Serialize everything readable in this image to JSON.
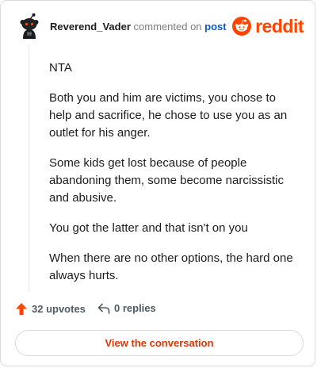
{
  "header": {
    "author": "Reverend_Vader",
    "action_text": "commented on",
    "post_link": "post",
    "brand": "reddit"
  },
  "comment": {
    "paragraphs": [
      "NTA",
      "Both you and him are victims, you chose to help and sacrifice, he chose to use you as an outlet for his anger.",
      "Some kids get lost because of people abandoning them, some become narcissistic and abusive.",
      "You got the latter and that isn't on you",
      "When there are no other options, the hard one always hurts."
    ]
  },
  "actions": {
    "upvotes": "32 upvotes",
    "replies": "0 replies"
  },
  "cta": {
    "label": "View the conversation"
  },
  "colors": {
    "brand": "#ff4500",
    "upvote": "#ff4500",
    "cta_text": "#d93900",
    "link": "#0b57d0"
  },
  "icons": {
    "avatar": "snoo-avatar-icon",
    "brand": "reddit-logo-icon",
    "upvote": "upvote-arrow-icon",
    "reply": "reply-arrow-icon"
  }
}
